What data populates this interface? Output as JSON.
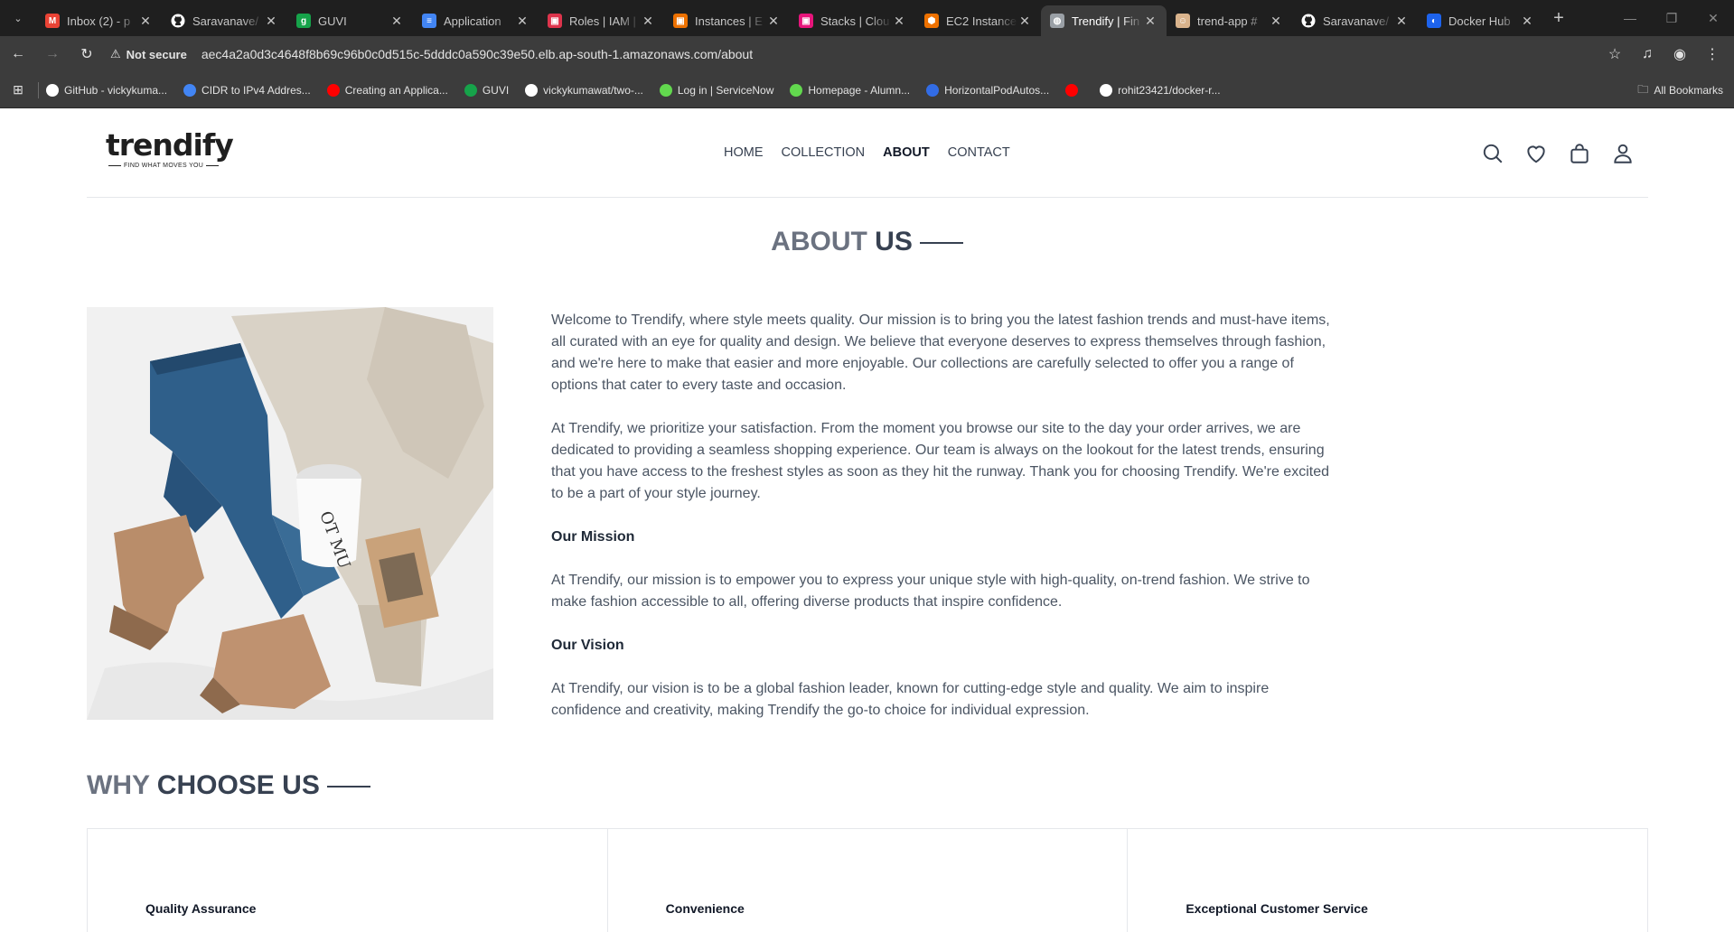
{
  "browser": {
    "tabs": [
      {
        "title": "Inbox (2) - p",
        "icon": "gmail-icon",
        "color": "#ea4335",
        "glyph": "M",
        "active": false
      },
      {
        "title": "Saravanave/",
        "icon": "github-icon",
        "color": "#ffffff",
        "glyph": "",
        "active": false
      },
      {
        "title": "GUVI",
        "icon": "guvi-icon",
        "color": "#16a34a",
        "glyph": "g",
        "active": false
      },
      {
        "title": "Application",
        "icon": "docs-icon",
        "color": "#4285f4",
        "glyph": "≡",
        "active": false
      },
      {
        "title": "Roles | IAM |",
        "icon": "aws-iam-icon",
        "color": "#dd344c",
        "glyph": "▣",
        "active": false
      },
      {
        "title": "Instances | E",
        "icon": "aws-ec2-icon",
        "color": "#ed7100",
        "glyph": "▣",
        "active": false
      },
      {
        "title": "Stacks | Clou",
        "icon": "aws-cloudformation-icon",
        "color": "#e7157b",
        "glyph": "▣",
        "active": false
      },
      {
        "title": "EC2 Instance",
        "icon": "aws-hex-icon",
        "color": "#ed7100",
        "glyph": "⬢",
        "active": false
      },
      {
        "title": "Trendify | Fin",
        "icon": "globe-icon",
        "color": "#9aa0a6",
        "glyph": "◍",
        "active": true
      },
      {
        "title": "trend-app #",
        "icon": "jenkins-icon",
        "color": "#d9b38c",
        "glyph": "☺",
        "active": false
      },
      {
        "title": "Saravanave/",
        "icon": "github-icon",
        "color": "#ffffff",
        "glyph": "",
        "active": false
      },
      {
        "title": "Docker Hub",
        "icon": "docker-icon",
        "color": "#1d63ed",
        "glyph": "◐",
        "active": false
      }
    ],
    "address": {
      "security_label": "Not secure",
      "url": "aec4a2a0d3c4648f8b69c96b0c0d515c-5dddc0a590c39e50.elb.ap-south-1.amazonaws.com/about"
    },
    "bookmarks": [
      {
        "label": "GitHub - vickykuma...",
        "color": "#ffffff"
      },
      {
        "label": "CIDR to IPv4 Addres...",
        "color": "#4285f4"
      },
      {
        "label": "Creating an Applica...",
        "color": "#ff0000"
      },
      {
        "label": "GUVI",
        "color": "#16a34a"
      },
      {
        "label": "vickykumawat/two-...",
        "color": "#ffffff"
      },
      {
        "label": "Log in | ServiceNow",
        "color": "#62d84e"
      },
      {
        "label": "Homepage - Alumn...",
        "color": "#62d84e"
      },
      {
        "label": "HorizontalPodAutos...",
        "color": "#326ce5"
      },
      {
        "label": "",
        "color": "#ff0000"
      },
      {
        "label": "rohit23421/docker-r...",
        "color": "#ffffff"
      }
    ],
    "all_bookmarks": "All Bookmarks"
  },
  "site": {
    "logo": {
      "word": "trendify",
      "tagline": "FIND WHAT MOVES YOU"
    },
    "nav": [
      {
        "label": "HOME",
        "active": false
      },
      {
        "label": "COLLECTION",
        "active": false
      },
      {
        "label": "ABOUT",
        "active": true
      },
      {
        "label": "CONTACT",
        "active": false
      }
    ]
  },
  "about": {
    "title_a": "ABOUT",
    "title_b": "US",
    "intro_1": "Welcome to Trendify, where style meets quality. Our mission is to bring you the latest fashion trends and must-have items, all curated with an eye for quality and design. We believe that everyone deserves to express themselves through fashion, and we're here to make that easier and more enjoyable. Our collections are carefully selected to offer you a range of options that cater to every taste and occasion.",
    "intro_2": "At Trendify, we prioritize your satisfaction. From the moment you browse our site to the day your order arrives, we are dedicated to providing a seamless shopping experience. Our team is always on the lookout for the latest trends, ensuring that you have access to the freshest styles as soon as they hit the runway. Thank you for choosing Trendify. We're excited to be a part of your style journey.",
    "mission_heading": "Our Mission",
    "mission_text": "At Trendify, our mission is to empower you to express your unique style with high-quality, on-trend fashion. We strive to make fashion accessible to all, offering diverse products that inspire confidence.",
    "vision_heading": "Our Vision",
    "vision_text": "At Trendify, our vision is to be a global fashion leader, known for cutting-edge style and quality. We aim to inspire confidence and creativity, making Trendify the go-to choice for individual expression."
  },
  "why": {
    "title_a": "WHY",
    "title_b": "CHOOSE US",
    "features": [
      {
        "title": "Quality Assurance"
      },
      {
        "title": "Convenience"
      },
      {
        "title": "Exceptional Customer Service"
      }
    ]
  }
}
